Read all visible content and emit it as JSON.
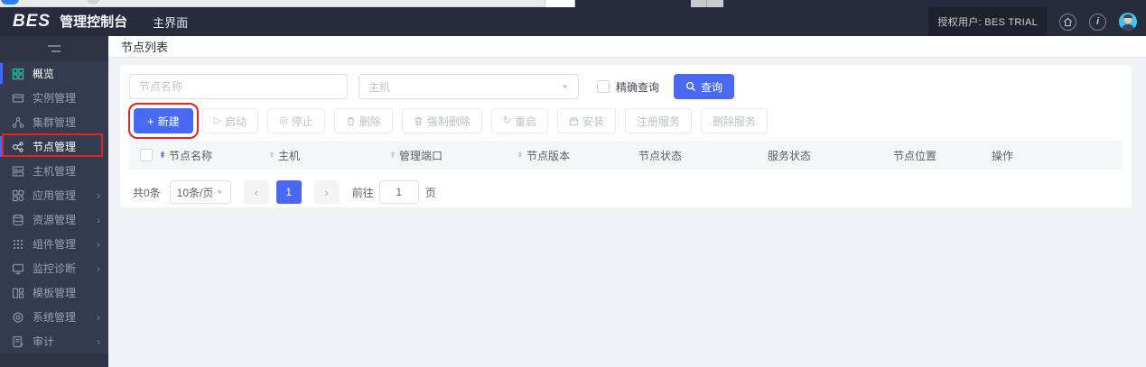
{
  "header": {
    "logo_bes": "BES",
    "logo_suffix": "管理控制台",
    "tab_main": "主界面",
    "authorized_user": "授权用户: BES TRIAL",
    "info_glyph": "i"
  },
  "glyphs": {
    "chevron_right": "›",
    "caret_up": "▲",
    "caret_down": "▼",
    "select_caret": "▼",
    "prev": "‹",
    "next": "›",
    "plus": "+",
    "play": "▷",
    "stop": "◎",
    "restart": "↻"
  },
  "sidebar": {
    "items": [
      {
        "label": "概览"
      },
      {
        "label": "实例管理"
      },
      {
        "label": "集群管理"
      },
      {
        "label": "节点管理"
      },
      {
        "label": "主机管理"
      },
      {
        "label": "应用管理"
      },
      {
        "label": "资源管理"
      },
      {
        "label": "组件管理"
      },
      {
        "label": "监控诊断"
      },
      {
        "label": "模板管理"
      },
      {
        "label": "系统管理"
      },
      {
        "label": "审计"
      }
    ]
  },
  "page": {
    "title": "节点列表"
  },
  "filters": {
    "node_name_placeholder": "节点名称",
    "host_placeholder": "主机",
    "exact_query_label": "精确查询",
    "search_label": "查询"
  },
  "toolbar": {
    "buttons": [
      {
        "label": "新建"
      },
      {
        "label": "启动"
      },
      {
        "label": "停止"
      },
      {
        "label": "删除"
      },
      {
        "label": "强制删除"
      },
      {
        "label": "重启"
      },
      {
        "label": "安装"
      },
      {
        "label": "注册服务"
      },
      {
        "label": "删除服务"
      }
    ]
  },
  "table": {
    "columns": [
      {
        "label": "节点名称",
        "sortable": true
      },
      {
        "label": "主机",
        "sortable": true
      },
      {
        "label": "管理端口",
        "sortable": true
      },
      {
        "label": "节点版本",
        "sortable": true
      },
      {
        "label": "节点状态",
        "sortable": false
      },
      {
        "label": "服务状态",
        "sortable": false
      },
      {
        "label": "节点位置",
        "sortable": false
      },
      {
        "label": "操作",
        "sortable": false
      }
    ],
    "rows": []
  },
  "pagination": {
    "total_text": "共0条",
    "page_size": "10条/页",
    "current_page": "1",
    "goto_label": "前往",
    "goto_value": "1",
    "page_unit": "页"
  },
  "colors": {
    "accent": "#4a69f2",
    "annotation_red": "#e62222",
    "active_icon_teal": "#1fc0a3",
    "header_bg": "#262c3c",
    "sidebar_bg": "#343b4d"
  }
}
